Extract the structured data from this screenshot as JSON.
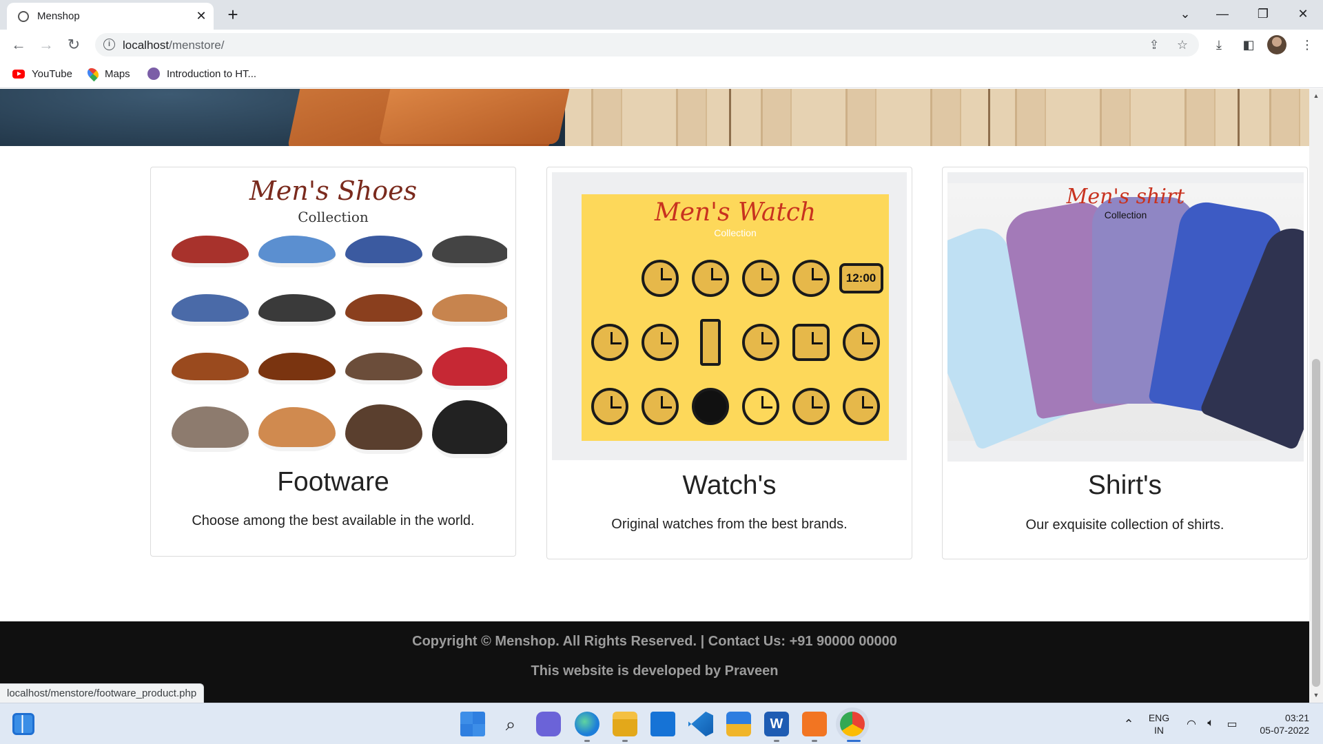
{
  "browser": {
    "tab_title": "Menshop",
    "tab_close": "✕",
    "new_tab": "+",
    "address_host": "localhost",
    "address_path": "/menstore/",
    "bookmarks": [
      {
        "label": "YouTube",
        "icon": "youtube-icon"
      },
      {
        "label": "Maps",
        "icon": "maps-icon"
      },
      {
        "label": "Introduction to HT...",
        "icon": "site-icon"
      }
    ],
    "window_controls": [
      "⌄",
      "—",
      "❐",
      "✕"
    ]
  },
  "cards": [
    {
      "poster_title": "Men's Shoes",
      "poster_subtitle": "Collection",
      "title": "Footware",
      "description": "Choose among the best available in the world.",
      "link": "localhost/menstore/footware_product.php"
    },
    {
      "poster_title": "Men's Watch",
      "poster_subtitle": "Collection",
      "clock_text": "12:00",
      "title": "Watch's",
      "description": "Original watches from the best brands."
    },
    {
      "poster_title": "Men's shirt",
      "poster_subtitle": "Collection",
      "title": "Shirt's",
      "description": "Our exquisite collection of shirts."
    }
  ],
  "footer": {
    "copyright": "Copyright © Menshop. All Rights Reserved. | Contact Us: +91 90000 00000",
    "developer": "This website is developed by Praveen"
  },
  "status_bar_url": "localhost/menstore/footware_product.php",
  "taskbar": {
    "language_line1": "ENG",
    "language_line2": "IN",
    "time": "03:21",
    "date": "05-07-2022"
  },
  "colors": {
    "footer_bg": "#101010",
    "footer_text": "#9c9c9c",
    "watch_poster_bg": "#fdd85a",
    "poster_title_red": "#b32d1e"
  }
}
